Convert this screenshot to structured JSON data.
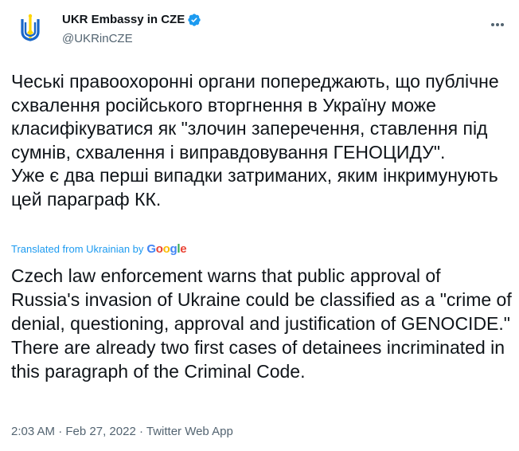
{
  "tweet": {
    "author": {
      "display_name": "UKR Embassy in CZE",
      "handle": "@UKRinCZE",
      "verified_icon": "verified-badge-icon",
      "avatar_colors": {
        "blue": "#1967c9",
        "yellow": "#ffd500"
      }
    },
    "more_icon": "more-dots-icon",
    "text": "Чеські правоохоронні органи попереджають, що публічне схвалення російського вторгнення в Україну може класифікуватися як \"злочин заперечення, ставлення під сумнів, схвалення і виправдовування ГЕНОЦИДУ\".\nУже є два перші випадки затриманих, яким інкримунують цей параграф КК.",
    "translation": {
      "label": "Translated from Ukrainian by",
      "provider": "Google",
      "text": "Czech law enforcement warns that public approval of Russia's invasion of Ukraine could be classified as a \"crime of denial, questioning, approval and justification of GENOCIDE.\"\n There are already two first cases of detainees incriminated in this paragraph of the Criminal Code."
    },
    "meta": {
      "time": "2:03 AM",
      "separator": " · ",
      "date": "Feb 27, 2022",
      "app": "Twitter Web App"
    },
    "colors": {
      "accent": "#1d9bf0",
      "text": "#0f1419",
      "muted": "#536471"
    }
  }
}
